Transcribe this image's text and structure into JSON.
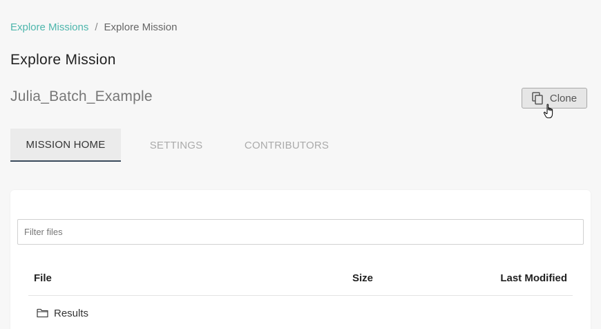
{
  "breadcrumb": {
    "link_label": "Explore Missions",
    "separator": "/",
    "current_label": "Explore Mission"
  },
  "page_title": "Explore Mission",
  "mission": {
    "name": "Julia_Batch_Example"
  },
  "actions": {
    "clone_label": "Clone",
    "clone_icon": "copy-icon"
  },
  "tabs": [
    {
      "label": "MISSION HOME",
      "active": true
    },
    {
      "label": "SETTINGS",
      "active": false
    },
    {
      "label": "CONTRIBUTORS",
      "active": false
    }
  ],
  "files": {
    "filter_placeholder": "Filter files",
    "filter_value": "",
    "columns": {
      "file": "File",
      "size": "Size",
      "last_modified": "Last Modified"
    },
    "rows": [
      {
        "name": "Results",
        "type": "folder",
        "icon": "folder-icon",
        "size": "",
        "last_modified": ""
      }
    ]
  },
  "colors": {
    "accent_link": "#4db6ac",
    "active_tab_underline": "#3a4a5c",
    "background": "#f7f7f7"
  }
}
